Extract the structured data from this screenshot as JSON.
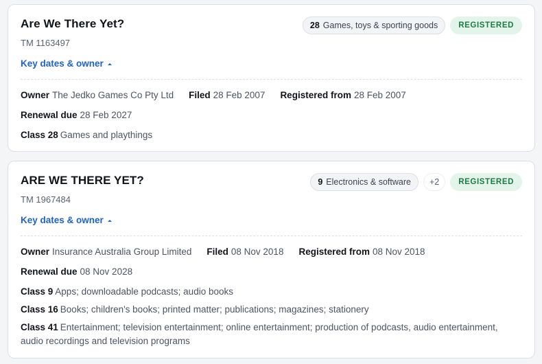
{
  "cards": [
    {
      "title": "Are We There Yet?",
      "tm_number": "TM 1163497",
      "key_dates_label": "Key dates & owner",
      "primary_class": {
        "num": "28",
        "label": "Games, toys & sporting goods"
      },
      "status": "REGISTERED",
      "owner_label": "Owner",
      "owner": "The Jedko Games Co Pty Ltd",
      "filed_label": "Filed",
      "filed": "28 Feb 2007",
      "registered_label": "Registered from",
      "registered": "28 Feb 2007",
      "renewal_label": "Renewal due",
      "renewal": "28 Feb 2027",
      "classes": [
        {
          "label": "Class 28",
          "desc": "Games and playthings"
        }
      ]
    },
    {
      "title": "ARE WE THERE YET?",
      "tm_number": "TM 1967484",
      "key_dates_label": "Key dates & owner",
      "primary_class": {
        "num": "9",
        "label": "Electronics & software"
      },
      "more_classes": "+2",
      "status": "REGISTERED",
      "owner_label": "Owner",
      "owner": "Insurance Australia Group Limited",
      "filed_label": "Filed",
      "filed": "08 Nov 2018",
      "registered_label": "Registered from",
      "registered": "08 Nov 2018",
      "renewal_label": "Renewal due",
      "renewal": "08 Nov 2028",
      "classes": [
        {
          "label": "Class 9",
          "desc": "Apps; downloadable podcasts; audio books"
        },
        {
          "label": "Class 16",
          "desc": "Books; children's books; printed matter; publications; magazines; stationery"
        },
        {
          "label": "Class 41",
          "desc": "Entertainment; television entertainment; online entertainment; production of podcasts, audio entertainment, audio recordings and television programs"
        }
      ]
    }
  ],
  "colors": {
    "link": "#1f63c6",
    "status_bg": "#e3f4ea",
    "status_text": "#1e7a44"
  }
}
